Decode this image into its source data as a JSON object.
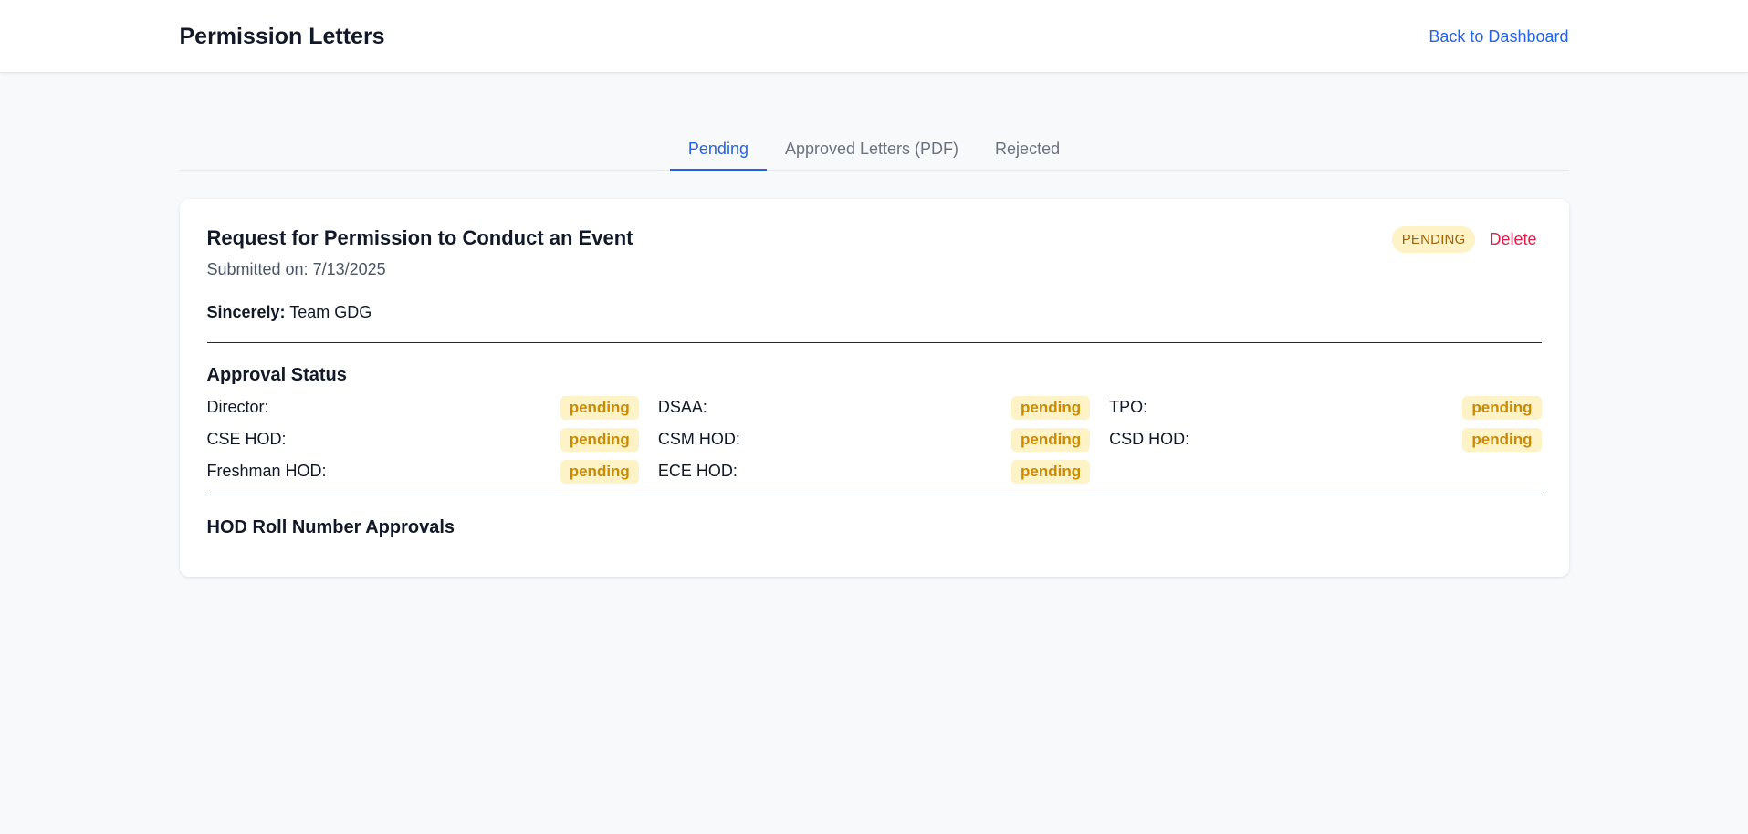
{
  "header": {
    "title": "Permission Letters",
    "back_link": "Back to Dashboard"
  },
  "tabs": [
    {
      "label": "Pending",
      "active": true
    },
    {
      "label": "Approved Letters (PDF)",
      "active": false
    },
    {
      "label": "Rejected",
      "active": false
    }
  ],
  "letter": {
    "title": "Request for Permission to Conduct an Event",
    "submitted": "Submitted on: 7/13/2025",
    "status": "PENDING",
    "delete_label": "Delete",
    "sincerely_label": "Sincerely:",
    "sincerely_value": "Team GDG",
    "approval_status_title": "Approval Status",
    "approvals": [
      {
        "label": "Director:",
        "status": "pending"
      },
      {
        "label": "DSAA:",
        "status": "pending"
      },
      {
        "label": "TPO:",
        "status": "pending"
      },
      {
        "label": "CSE HOD:",
        "status": "pending"
      },
      {
        "label": "CSM HOD:",
        "status": "pending"
      },
      {
        "label": "CSD HOD:",
        "status": "pending"
      },
      {
        "label": "Freshman HOD:",
        "status": "pending"
      },
      {
        "label": "ECE HOD:",
        "status": "pending"
      }
    ],
    "hod_roll_title": "HOD Roll Number Approvals"
  },
  "colors": {
    "accent": "#2563eb",
    "danger": "#e11d48",
    "pending_bg": "#fef3c7",
    "pending_text": "#ca8a04",
    "page_bg": "#f8f9fb"
  }
}
